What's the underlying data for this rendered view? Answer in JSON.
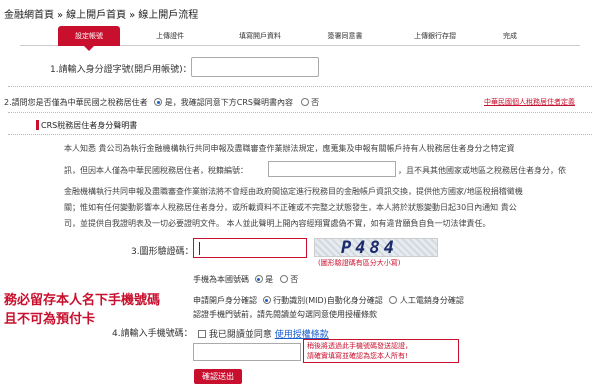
{
  "breadcrumb": [
    "金融網首頁",
    "線上開戶首頁",
    "線上開戶流程"
  ],
  "breadcrumb_separator": "»",
  "steps": [
    "設定帳號",
    "上傳證件",
    "填寫開戶資料",
    "簽署同意書",
    "上傳銀行存摺",
    "完成"
  ],
  "active_step_index": 0,
  "q1_label": "1.請輸入身分證字號(開戶用帳號)：",
  "q1_value": "",
  "q2": {
    "label": "2.請問您是否僅為中華民國之稅務居住者",
    "yes_label": "是，我確認同意下方CRS聲明書內容",
    "no_label": "否",
    "selected": "yes",
    "link": "中華民國個人稅務居住者定義"
  },
  "crs_title": "CRS稅務居住者身分聲明書",
  "declaration": {
    "line1": "本人知悉 貴公司為執行金融機構執行共同申報及盡職審查作業辦法規定，應蒐集及申報有關帳戶持有人稅務居住者身分之特定資",
    "line2_a": "訊，但因本人僅為中華民國稅務居住者，稅籍編號：",
    "line2_b": "，且不具其他國家或地區之稅務居住者身分，依",
    "line3": "金融機構執行共同申報及盡職審查作業辦法將不會經由政府間協定進行稅務目的金融帳戶資訊交換，提供他方國家/地區稅捐稽徵機",
    "line4": "關；惟如有任何變動影響本人稅務居住者身分，或所載資料不正確或不完整之狀態發生，本人將於狀態變動日起30日內通知 貴公",
    "line5": "司，並提供自我證明表及一切必要證明文件。 本人並此聲明上開內容經翔實處偽不實，如有違背願負自負一切法律責任。",
    "tax_id_value": ""
  },
  "q3_label": "3.圖形驗證碼：",
  "captcha_input_value": "",
  "captcha_text": "P484",
  "captcha_note": "(圖形驗證碼有區分大小寫)",
  "mobile": {
    "label": "手機為本國號碼",
    "yes": "是",
    "no": "否",
    "selected": "yes"
  },
  "red_note": [
    "務必留存本人名下手機號碼",
    "且不可為預付卡"
  ],
  "auth": {
    "label": "申請開戶身分確認",
    "option1": "行動識別(MID)自動化身分確認",
    "option2": "人工電銷身分確認",
    "selected": "option1",
    "hint": "認證手機門號前，請先閱讀並勾選同意使用授權條款"
  },
  "q4_label": "4.請輸入手機號碼：",
  "agree_text": "我已閱讀並同意",
  "agree_link": "使用授權條款",
  "agree_checked": false,
  "phone_value": "",
  "warn_box": [
    "稍後將透過此手機號碼發送認證，",
    "請確實填寫並確認為您本人所有!"
  ],
  "submit_label": "確認送出",
  "colors": {
    "accent": "#c8102e",
    "link": "#1a5fd0"
  }
}
